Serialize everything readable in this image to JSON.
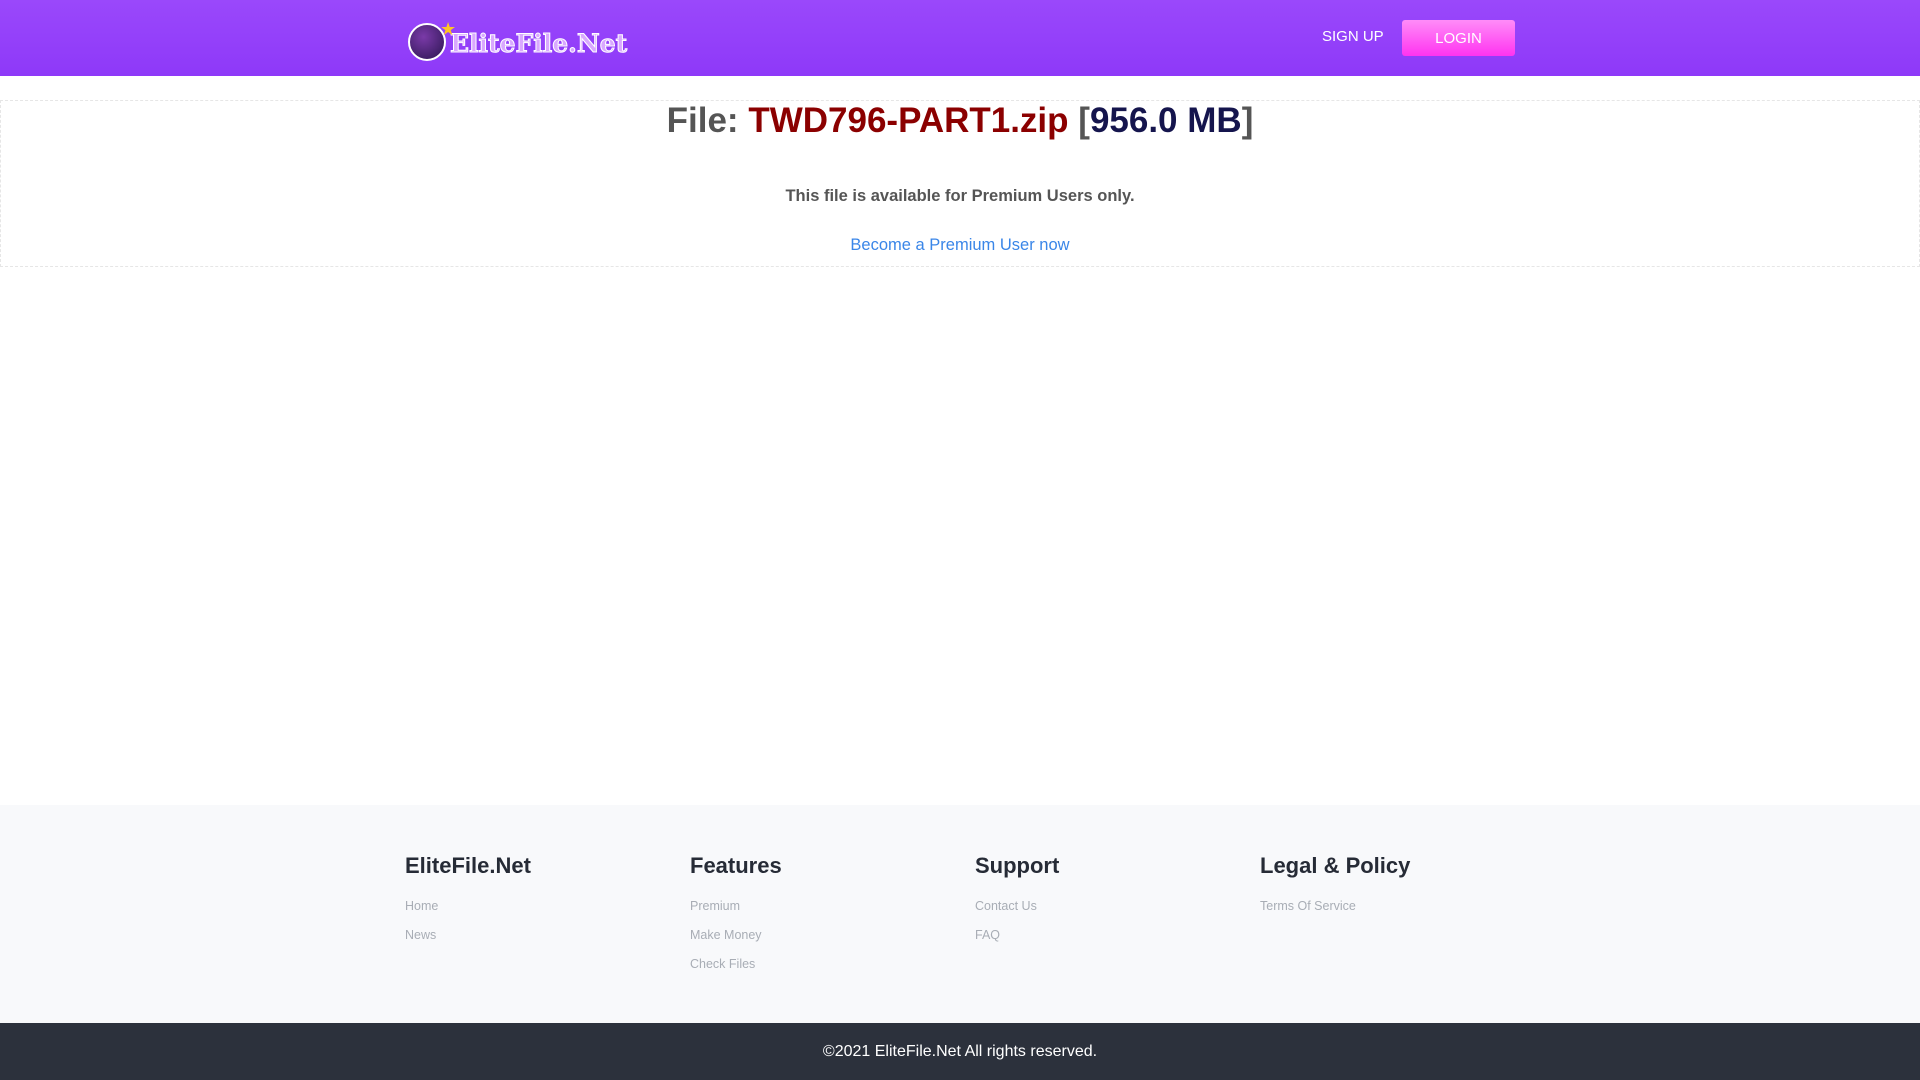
{
  "header": {
    "logo_text": "EliteFile.Net",
    "signup": "SIGN UP",
    "login": "LOGIN"
  },
  "file": {
    "prefix": "File: ",
    "name": "TWD796-PART1.zip",
    "size": "956.0 MB",
    "notice": "This file is available for Premium Users only.",
    "cta": "Become a Premium User now"
  },
  "footer": {
    "columns": [
      {
        "title": "EliteFile.Net",
        "links": [
          "Home",
          "News"
        ]
      },
      {
        "title": "Features",
        "links": [
          "Premium",
          "Make Money",
          "Check Files"
        ]
      },
      {
        "title": "Support",
        "links": [
          "Contact Us",
          "FAQ"
        ]
      },
      {
        "title": "Legal & Policy",
        "links": [
          "Terms Of Service"
        ]
      }
    ],
    "copyright": "©2021 EliteFile.Net All rights reserved."
  },
  "colors": {
    "header": "#9a48fb",
    "login": "#ff33f0",
    "link": "#3a86e8",
    "filename": "#8b0000"
  }
}
